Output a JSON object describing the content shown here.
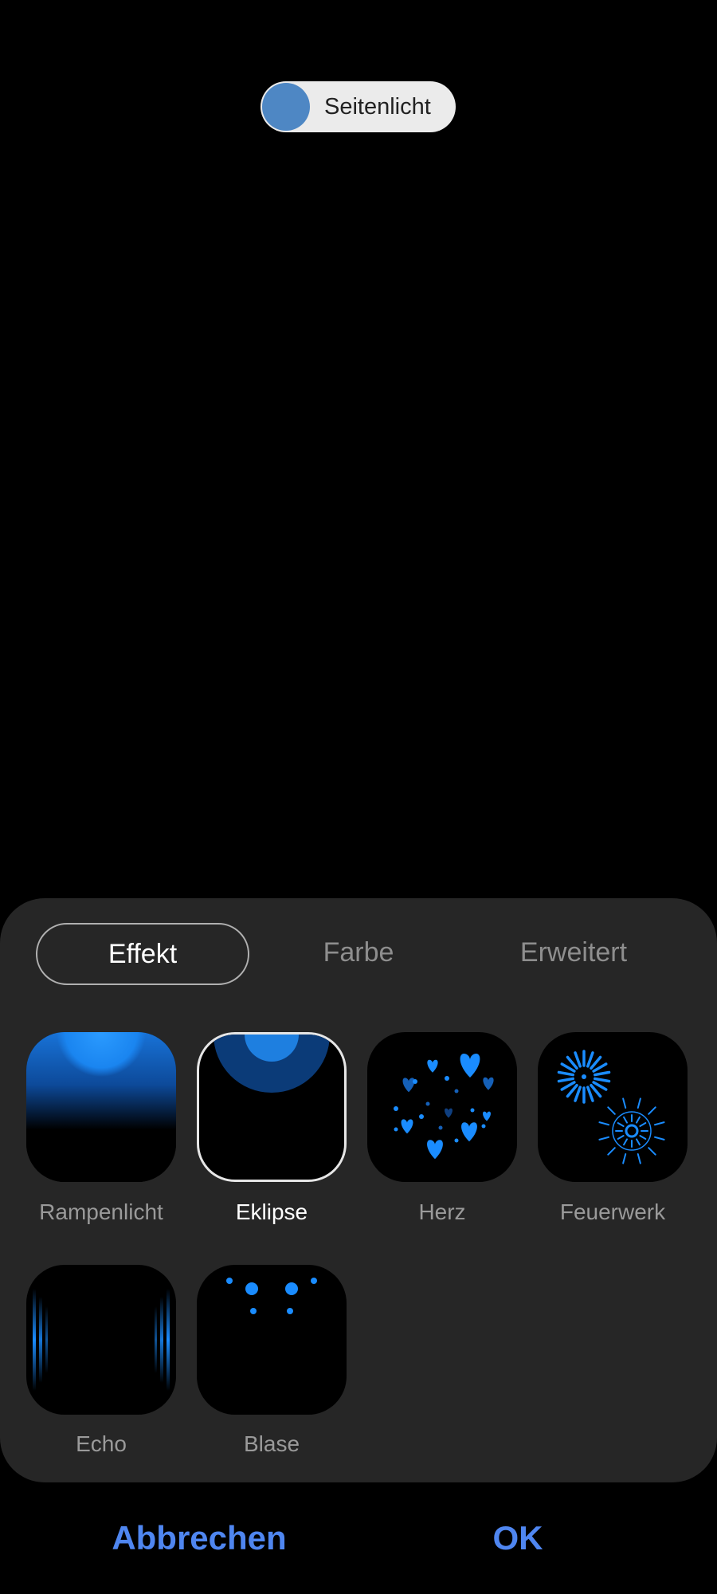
{
  "toggle": {
    "label": "Seitenlicht",
    "on": true
  },
  "tabs": [
    {
      "label": "Effekt",
      "active": true
    },
    {
      "label": "Farbe",
      "active": false
    },
    {
      "label": "Erweitert",
      "active": false
    }
  ],
  "effects": [
    {
      "label": "Rampenlicht",
      "icon": "spotlight-icon",
      "selected": false
    },
    {
      "label": "Eklipse",
      "icon": "eclipse-icon",
      "selected": true
    },
    {
      "label": "Herz",
      "icon": "heart-icon",
      "selected": false
    },
    {
      "label": "Feuerwerk",
      "icon": "firework-icon",
      "selected": false
    },
    {
      "label": "Echo",
      "icon": "echo-icon",
      "selected": false
    },
    {
      "label": "Blase",
      "icon": "bubble-icon",
      "selected": false
    }
  ],
  "footer": {
    "cancel_label": "Abbrechen",
    "ok_label": "OK"
  },
  "colors": {
    "accent": "#4f86f0",
    "effect_blue": "#1a8cff",
    "sheet": "#262626",
    "toggle_knob": "#4e87c4"
  }
}
